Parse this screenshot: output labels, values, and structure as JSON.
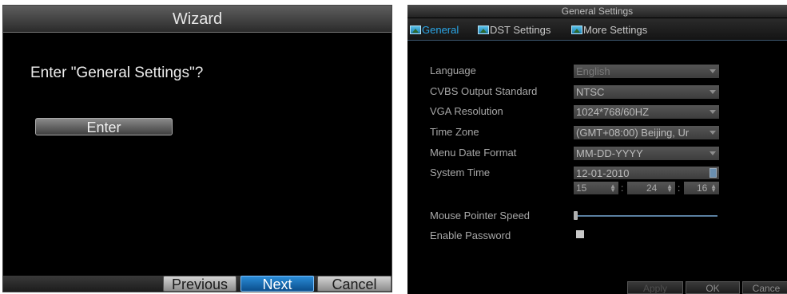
{
  "wizard": {
    "title": "Wizard",
    "question": "Enter \"General Settings\"?",
    "enter_label": "Enter",
    "buttons": {
      "previous": "Previous",
      "next": "Next",
      "cancel": "Cancel"
    }
  },
  "settings": {
    "title": "General Settings",
    "tabs": [
      {
        "label": "General",
        "icon": "image-icon",
        "active": true
      },
      {
        "label": "DST Settings",
        "icon": "image-icon",
        "active": false
      },
      {
        "label": "More Settings",
        "icon": "image-icon",
        "active": false
      }
    ],
    "fields": {
      "language": {
        "label": "Language",
        "value": "English"
      },
      "cvbs": {
        "label": "CVBS Output Standard",
        "value": "NTSC"
      },
      "vga": {
        "label": "VGA Resolution",
        "value": "1024*768/60HZ"
      },
      "timezone": {
        "label": "Time Zone",
        "value": "(GMT+08:00) Beijing, Ur"
      },
      "date_format": {
        "label": "Menu Date Format",
        "value": "MM-DD-YYYY"
      },
      "system_time": {
        "label": "System Time",
        "date": "12-01-2010",
        "hour": "15",
        "minute": "24",
        "second": "16"
      },
      "mouse_speed": {
        "label": "Mouse Pointer Speed",
        "level": 0
      },
      "enable_password": {
        "label": "Enable Password",
        "checked": false
      }
    },
    "buttons": {
      "apply": "Apply",
      "ok": "OK",
      "cancel": "Cance"
    }
  },
  "colors": {
    "accent": "#2aa7e8",
    "next_button": "#0b4e8c",
    "background": "#000000"
  }
}
